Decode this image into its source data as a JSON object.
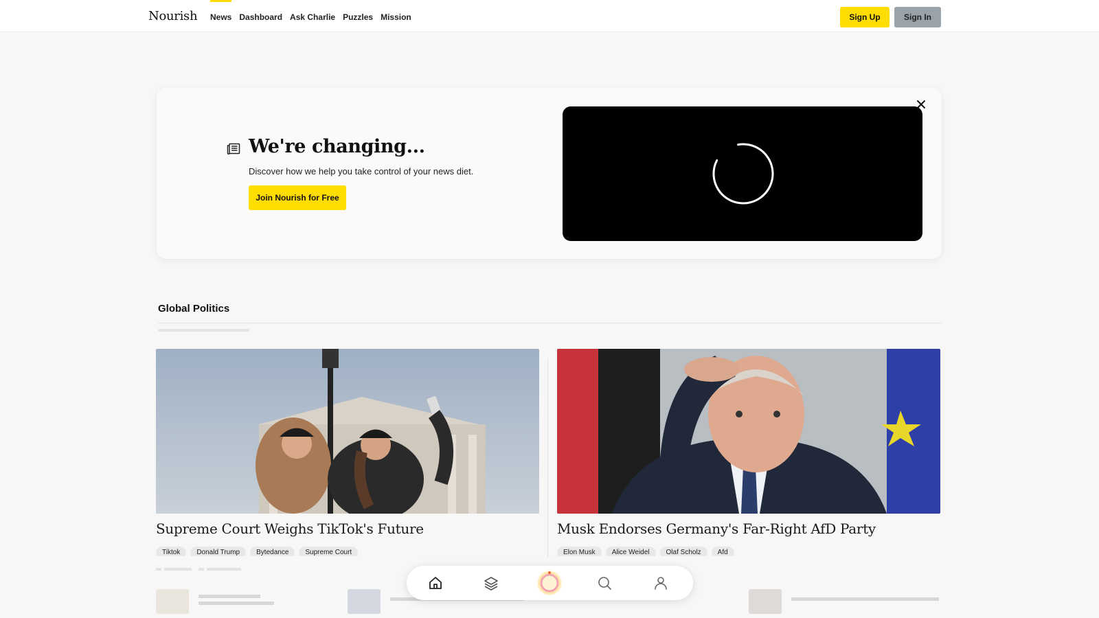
{
  "brand": {
    "logo": "Nourish",
    "accent": "#ffdd00"
  },
  "nav": {
    "items": [
      {
        "label": "News",
        "active": true
      },
      {
        "label": "Dashboard",
        "active": false
      },
      {
        "label": "Ask Charlie",
        "active": false
      },
      {
        "label": "Puzzles",
        "active": false
      },
      {
        "label": "Mission",
        "active": false
      }
    ],
    "signup": "Sign Up",
    "signin": "Sign In"
  },
  "promo": {
    "icon": "newspaper-icon",
    "title": "We're changing...",
    "subtitle": "Discover how we help you take control of your news diet.",
    "cta": "Join Nourish for Free",
    "video_state": "loading"
  },
  "section": {
    "title": "Global Politics"
  },
  "articles": [
    {
      "title": "Supreme Court Weighs TikTok's Future",
      "tags": [
        "Tiktok",
        "Donald Trump",
        "Bytedance",
        "Supreme Court"
      ]
    },
    {
      "title": "Musk Endorses Germany's Far-Right AfD Party",
      "tags": [
        "Elon Musk",
        "Alice Weidel",
        "Olaf Scholz",
        "Afd"
      ]
    }
  ],
  "bottom_nav": {
    "items": [
      "home-icon",
      "layers-icon",
      "nourish-ring-icon",
      "search-icon",
      "user-icon"
    ]
  }
}
